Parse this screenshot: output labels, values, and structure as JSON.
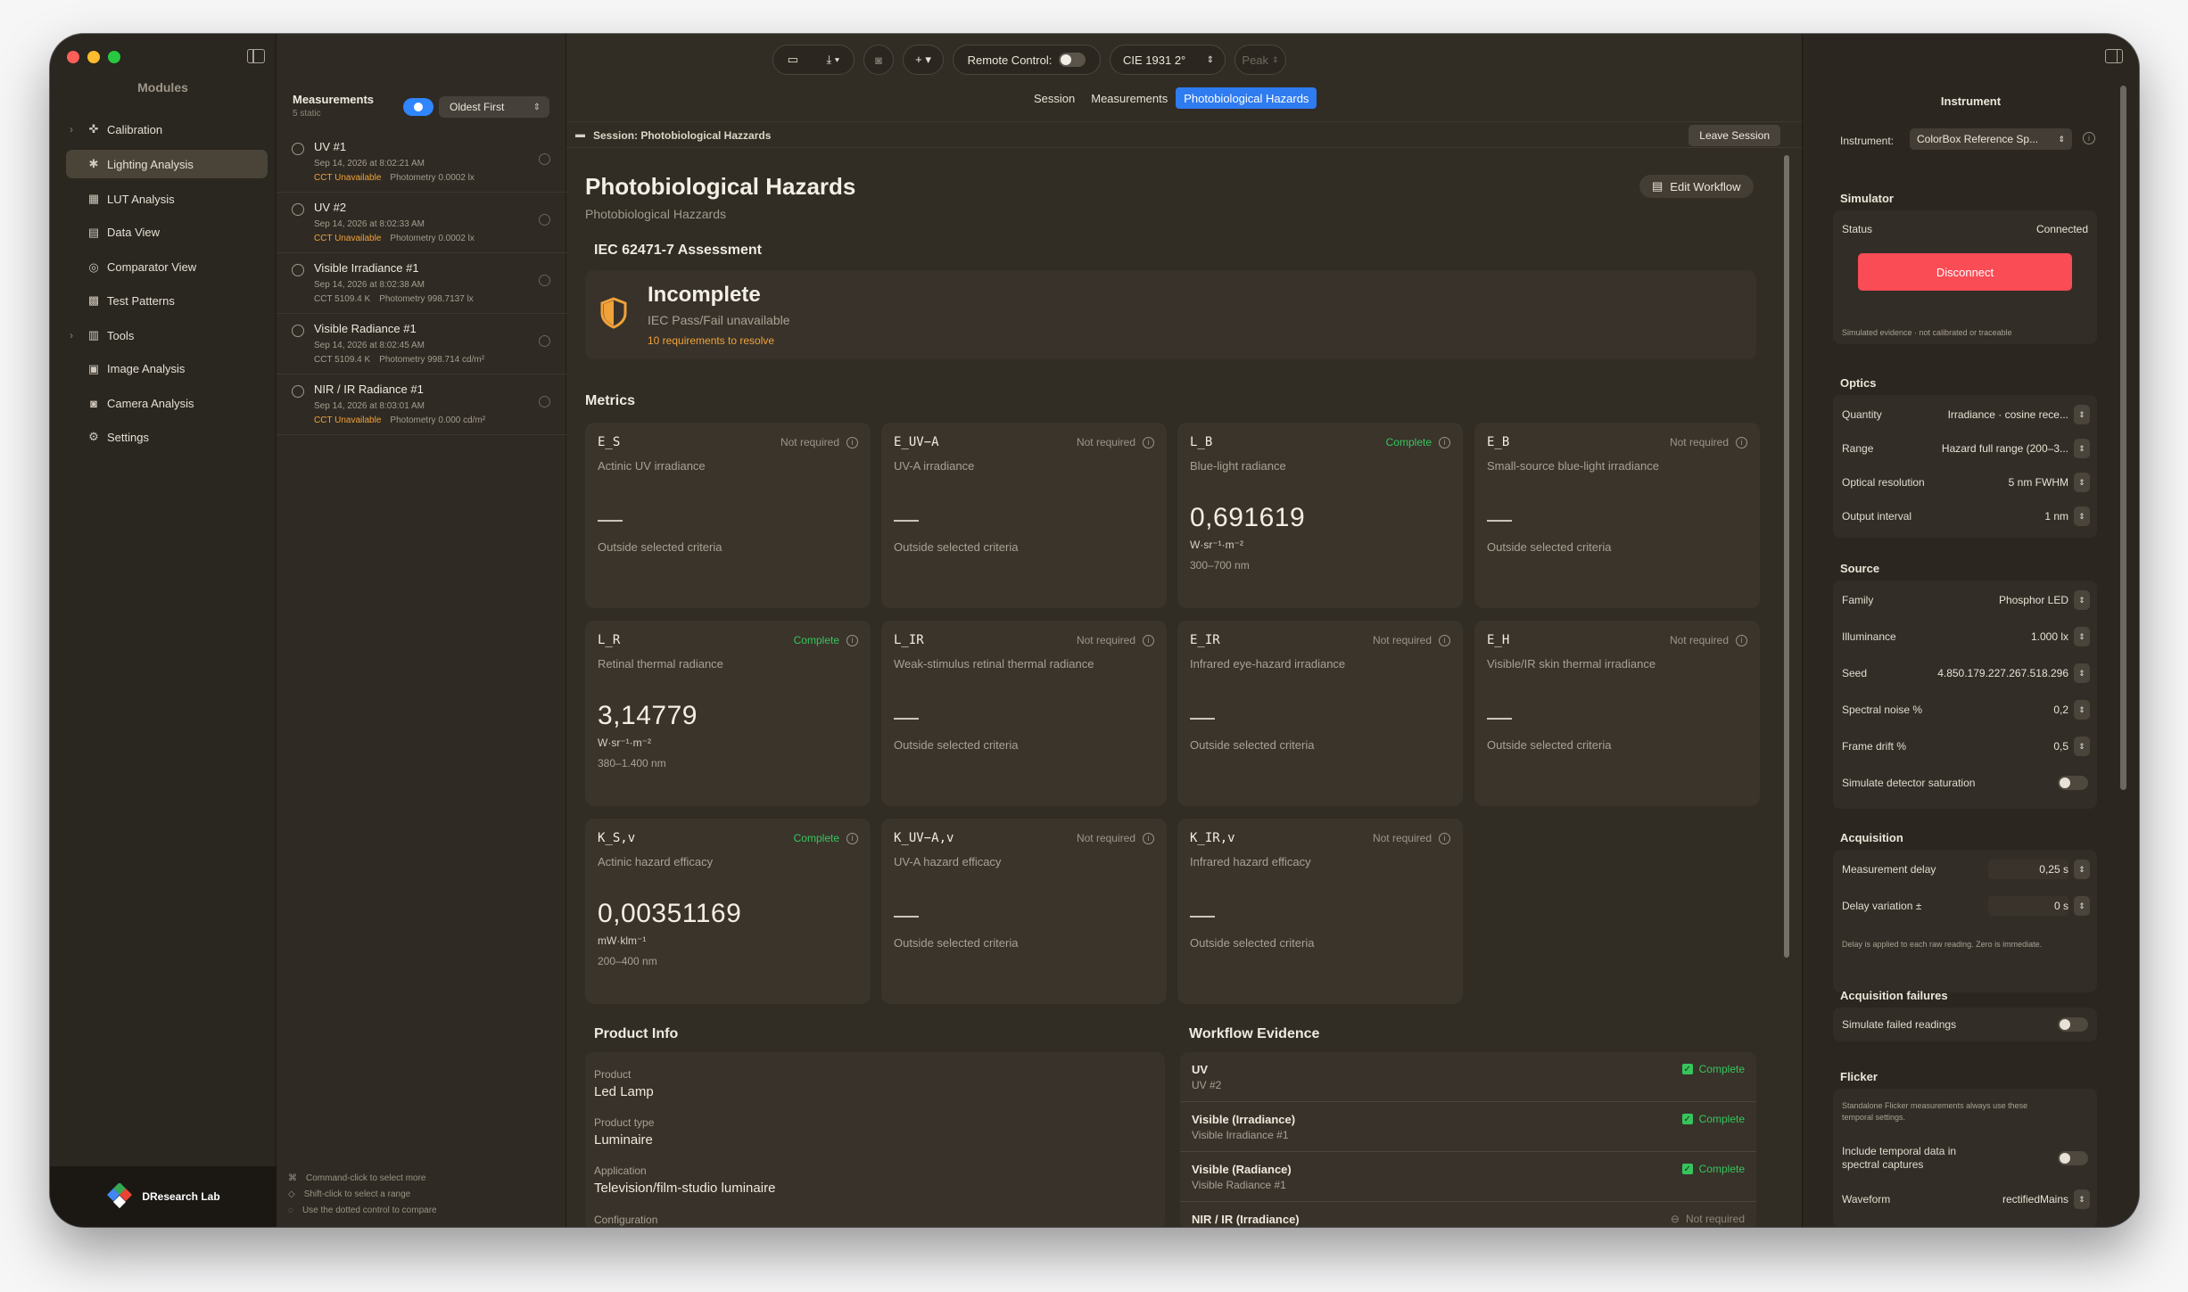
{
  "sidebar": {
    "title": "Modules",
    "items": [
      {
        "label": "Calibration",
        "icon": "crosshair-icon",
        "glyph": "✜",
        "chev": "›"
      },
      {
        "label": "Lighting Analysis",
        "icon": "lighting-icon",
        "glyph": "✱",
        "chev": ""
      },
      {
        "label": "LUT Analysis",
        "icon": "lut-icon",
        "glyph": "▦",
        "chev": ""
      },
      {
        "label": "Data View",
        "icon": "table-icon",
        "glyph": "▤",
        "chev": ""
      },
      {
        "label": "Comparator View",
        "icon": "comparator-icon",
        "glyph": "◎",
        "chev": ""
      },
      {
        "label": "Test Patterns",
        "icon": "grid-icon",
        "glyph": "▩",
        "chev": ""
      },
      {
        "label": "Tools",
        "icon": "tools-icon",
        "glyph": "▥",
        "chev": "›"
      },
      {
        "label": "Image Analysis",
        "icon": "image-icon",
        "glyph": "▣",
        "chev": ""
      },
      {
        "label": "Camera Analysis",
        "icon": "camera-icon",
        "glyph": "◙",
        "chev": ""
      },
      {
        "label": "Settings",
        "icon": "gear-icon",
        "glyph": "⚙",
        "chev": ""
      }
    ],
    "brand": "DResearch Lab"
  },
  "measurements": {
    "title": "Measurements",
    "subtitle": "5 static",
    "sort": "Oldest First",
    "items": [
      {
        "name": "UV #1",
        "date": "Sep 14, 2026 at 8:02:21 AM",
        "cct": "CCT Unavailable",
        "photometry": "Photometry 0.0002 lx"
      },
      {
        "name": "UV #2",
        "date": "Sep 14, 2026 at 8:02:33 AM",
        "cct": "CCT Unavailable",
        "photometry": "Photometry 0.0002 lx"
      },
      {
        "name": "Visible Irradiance #1",
        "date": "Sep 14, 2026 at 8:02:38 AM",
        "cct": "CCT 5109.4 K",
        "photometry": "Photometry 998.7137 lx"
      },
      {
        "name": "Visible Radiance #1",
        "date": "Sep 14, 2026 at 8:02:45 AM",
        "cct": "CCT 5109.4 K",
        "photometry": "Photometry 998.714 cd/m²"
      },
      {
        "name": "NIR / IR Radiance #1",
        "date": "Sep 14, 2026 at 8:03:01 AM",
        "cct": "CCT Unavailable",
        "photometry": "Photometry 0.000 cd/m²"
      }
    ],
    "hints": [
      "Command-click to select more",
      "Shift-click to select a range",
      "Use the dotted control to compare"
    ]
  },
  "toolbar": {
    "remote_label": "Remote Control:",
    "observer": "CIE 1931 2°",
    "peak": "Peak"
  },
  "tabs": [
    "Session",
    "Measurements",
    "Photobiological Hazards"
  ],
  "session": {
    "label": "Session: Photobiological Hazzards",
    "leave": "Leave Session"
  },
  "main": {
    "title": "Photobiological Hazards",
    "subtitle": "Photobiological Hazzards",
    "edit_workflow": "Edit Workflow",
    "assessment_title": "IEC 62471-7 Assessment",
    "assessment_status": "Incomplete",
    "assessment_sub": "IEC Pass/Fail unavailable",
    "assessment_warn": "10 requirements to resolve",
    "accent_warn": "#f0a23a",
    "metrics_title": "Metrics",
    "metrics": [
      {
        "code": "E_S",
        "status": "Not required",
        "desc": "Actinic UV irradiance",
        "value": "—",
        "note": "Outside selected criteria",
        "ok": false
      },
      {
        "code": "E_UV−A",
        "status": "Not required",
        "desc": "UV-A irradiance",
        "value": "—",
        "note": "Outside selected criteria",
        "ok": false
      },
      {
        "code": "L_B",
        "status": "Complete",
        "desc": "Blue-light radiance",
        "value": "0,691619",
        "unit": "W·sr⁻¹·m⁻²",
        "range": "300–700 nm",
        "ok": true
      },
      {
        "code": "E_B",
        "status": "Not required",
        "desc": "Small-source blue-light irradiance",
        "value": "—",
        "note": "Outside selected criteria",
        "ok": false
      },
      {
        "code": "L_R",
        "status": "Complete",
        "desc": "Retinal thermal radiance",
        "value": "3,14779",
        "unit": "W·sr⁻¹·m⁻²",
        "range": "380–1.400 nm",
        "ok": true
      },
      {
        "code": "L_IR",
        "status": "Not required",
        "desc": "Weak-stimulus retinal thermal radiance",
        "value": "—",
        "note": "Outside selected criteria",
        "ok": false
      },
      {
        "code": "E_IR",
        "status": "Not required",
        "desc": "Infrared eye-hazard irradiance",
        "value": "—",
        "note": "Outside selected criteria",
        "ok": false
      },
      {
        "code": "E_H",
        "status": "Not required",
        "desc": "Visible/IR skin thermal irradiance",
        "value": "—",
        "note": "Outside selected criteria",
        "ok": false
      },
      {
        "code": "K_S,v",
        "status": "Complete",
        "desc": "Actinic hazard efficacy",
        "value": "0,00351169",
        "unit": "mW·klm⁻¹",
        "range": "200–400 nm",
        "ok": true
      },
      {
        "code": "K_UV−A,v",
        "status": "Not required",
        "desc": "UV-A hazard efficacy",
        "value": "—",
        "note": "Outside selected criteria",
        "ok": false
      },
      {
        "code": "K_IR,v",
        "status": "Not required",
        "desc": "Infrared hazard efficacy",
        "value": "—",
        "note": "Outside selected criteria",
        "ok": false
      }
    ],
    "product_title": "Product Info",
    "product": [
      {
        "k": "Product",
        "v": "Led Lamp"
      },
      {
        "k": "Product type",
        "v": "Luminaire"
      },
      {
        "k": "Application",
        "v": "Television/film-studio luminaire"
      },
      {
        "k": "Configuration",
        "v": ""
      }
    ],
    "evidence_title": "Workflow Evidence",
    "evidence": [
      {
        "t": "UV",
        "s": "UV #2",
        "c": "Complete"
      },
      {
        "t": "Visible (Irradiance)",
        "s": "Visible Irradiance #1",
        "c": "Complete"
      },
      {
        "t": "Visible (Radiance)",
        "s": "Visible Radiance #1",
        "c": "Complete"
      },
      {
        "t": "NIR / IR (Irradiance)",
        "s": "",
        "c": "Not required"
      }
    ]
  },
  "inspector": {
    "title": "Instrument",
    "instrument_label": "Instrument:",
    "instrument_value": "ColorBox Reference Sp...",
    "simulator_title": "Simulator",
    "status_label": "Status",
    "status_value": "Connected",
    "disconnect": "Disconnect",
    "sim_note": "Simulated evidence · not calibrated or traceable",
    "optics_title": "Optics",
    "optics": [
      {
        "k": "Quantity",
        "v": "Irradiance · cosine rece..."
      },
      {
        "k": "Range",
        "v": "Hazard full range (200–3..."
      },
      {
        "k": "Optical resolution",
        "v": "5 nm FWHM"
      },
      {
        "k": "Output interval",
        "v": "1 nm"
      }
    ],
    "source_title": "Source",
    "source": [
      {
        "k": "Family",
        "v": "Phosphor LED"
      },
      {
        "k": "Illuminance",
        "v": "1.000  lx"
      },
      {
        "k": "Seed",
        "v": "4.850.179.227.267.518.296"
      },
      {
        "k": "Spectral noise %",
        "v": "0,2"
      },
      {
        "k": "Frame drift %",
        "v": "0,5"
      },
      {
        "k": "Simulate detector saturation",
        "v": ""
      }
    ],
    "acq_title": "Acquisition",
    "acq": [
      {
        "k": "Measurement delay",
        "v": "0,25   s"
      },
      {
        "k": "Delay variation ±",
        "v": "0   s"
      }
    ],
    "acq_note": "Delay is applied to each raw reading. Zero is immediate.",
    "fail_title": "Acquisition failures",
    "fail_label": "Simulate failed readings",
    "flicker_title": "Flicker",
    "flicker_note1": "Standalone Flicker measurements always use these",
    "flicker_note2": "temporal settings.",
    "flicker_toggle_1": "Include temporal data in",
    "flicker_toggle_2": "spectral captures",
    "waveform_label": "Waveform",
    "waveform_value": "rectifiedMains"
  },
  "colors": {
    "accent": "#2f7bf0",
    "ok": "#36c55c",
    "danger": "#f94c55",
    "warn": "#f0a23a"
  }
}
